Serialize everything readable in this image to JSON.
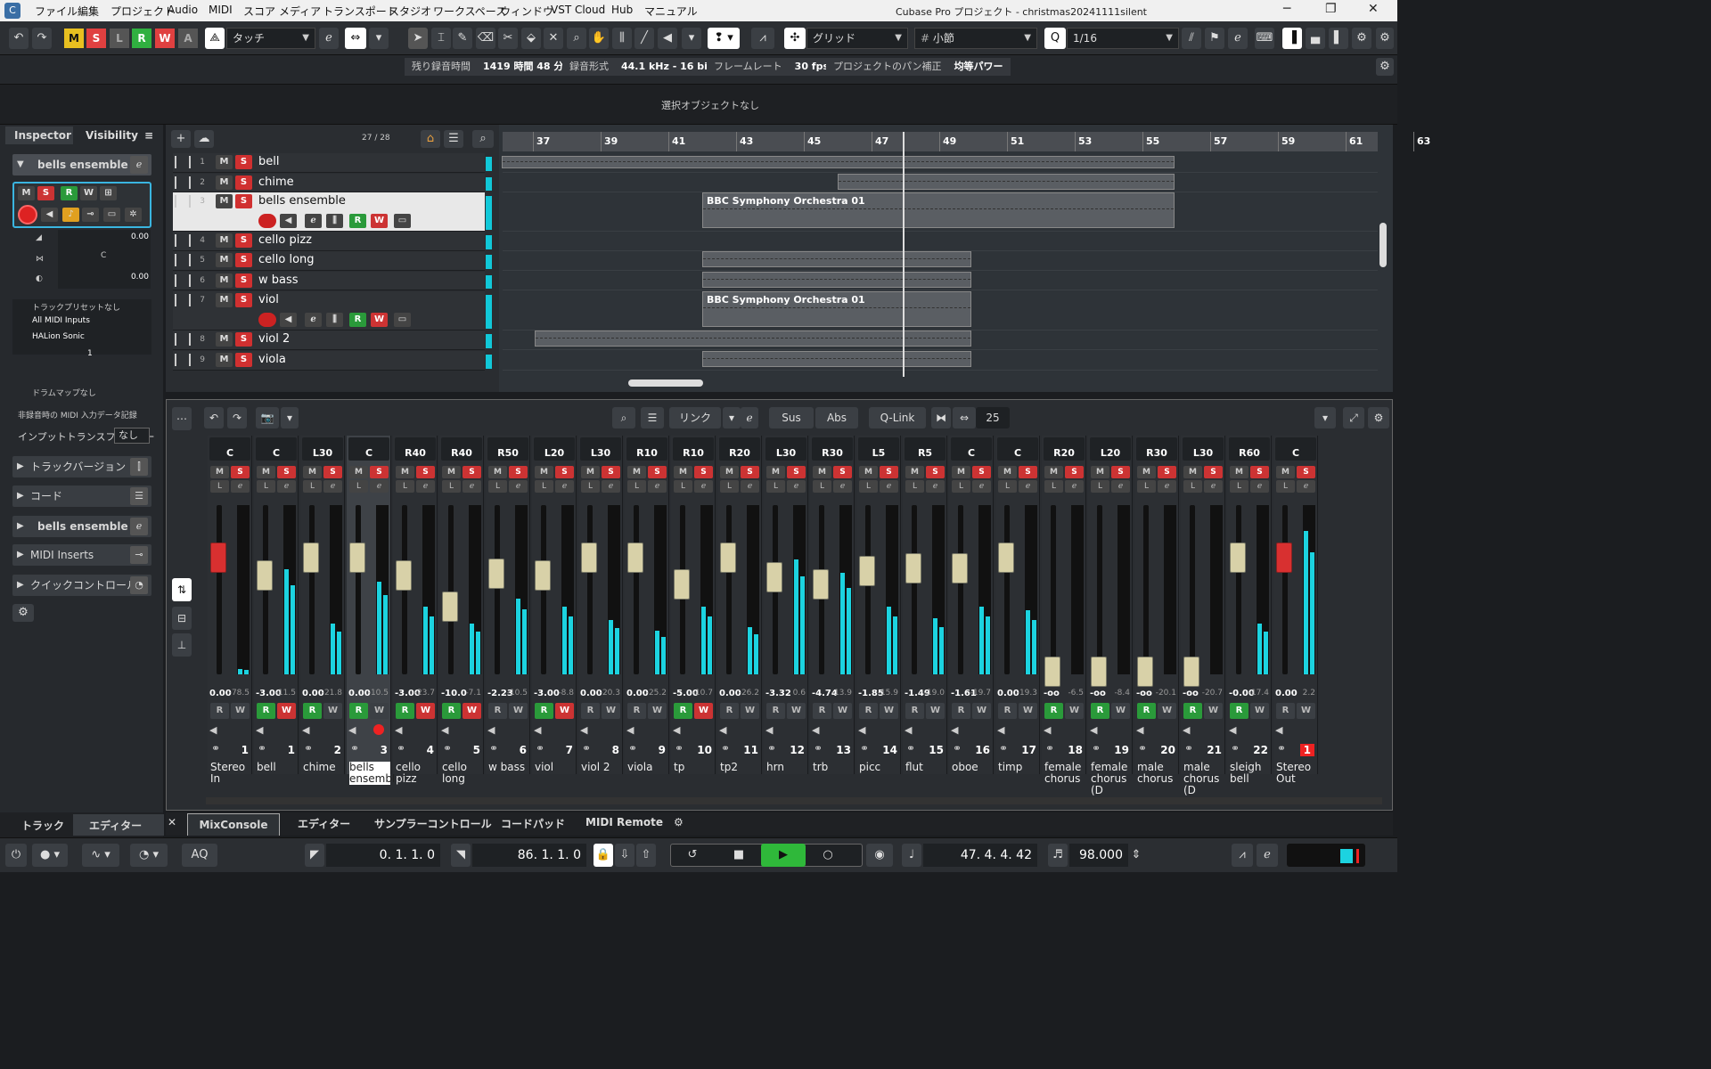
{
  "menu": [
    "ファイル",
    "編集",
    "プロジェクト",
    "Audio",
    "MIDI",
    "スコア",
    "メディア",
    "トランスポート",
    "スタジオ",
    "ワークスペース",
    "ウィンドウ",
    "VST Cloud",
    "Hub",
    "マニュアル"
  ],
  "window_title": "Cubase Pro プロジェクト - christmas20241111silent",
  "toolbar": {
    "modes": [
      "M",
      "S",
      "L",
      "R",
      "W",
      "A"
    ],
    "automation_mode": "タッチ",
    "snap_type": "グリッド",
    "grid_type": "小節",
    "quantize": "1/16"
  },
  "status": {
    "rec_time_label": "残り録音時間",
    "rec_time": "1419 時間 48 分",
    "rec_format_label": "録音形式",
    "rec_format": "44.1 kHz - 16 bit",
    "frame_rate_label": "フレームレート",
    "frame_rate": "30 fps",
    "pan_label": "プロジェクトのパン補正",
    "pan_value": "均等パワー"
  },
  "info_line": "選択オブジェクトなし",
  "inspector": {
    "tab_inspector": "Inspector",
    "tab_visibility": "Visibility",
    "track_name": "bells ensemble",
    "volume": "0.00",
    "pan": "C",
    "delay": "0.00",
    "preset": "トラックプリセットなし",
    "input": "All MIDI Inputs",
    "output": "HALion Sonic",
    "channel": "1",
    "drum_map": "ドラムマップなし",
    "midi_record": "非録音時の MIDI 入力データ記録",
    "input_transformer_label": "インプットトランスフォーマー",
    "input_transformer_value": "なし",
    "sections": [
      "トラックバージョン",
      "コード",
      "bells ensemble",
      "MIDI Inserts",
      "クイックコントロール"
    ]
  },
  "tracklist": {
    "counter": "27 / 28",
    "tracks": [
      {
        "num": "1",
        "name": "bell"
      },
      {
        "num": "2",
        "name": "chime"
      },
      {
        "num": "3",
        "name": "bells ensemble"
      },
      {
        "num": "4",
        "name": "cello pizz"
      },
      {
        "num": "5",
        "name": "cello long"
      },
      {
        "num": "6",
        "name": "w bass"
      },
      {
        "num": "7",
        "name": "viol"
      },
      {
        "num": "8",
        "name": "viol  2"
      },
      {
        "num": "9",
        "name": "viola"
      }
    ]
  },
  "ruler": [
    "37",
    "39",
    "41",
    "43",
    "45",
    "47",
    "49",
    "51",
    "53",
    "55",
    "57",
    "59",
    "61",
    "63"
  ],
  "parts": {
    "bbc": "BBC Symphony Orchestra 01"
  },
  "mixer": {
    "link": "リンク",
    "sus": "Sus",
    "abs": "Abs",
    "qlink": "Q-Link",
    "count": "25",
    "channels": [
      {
        "pan": "C",
        "val": "0.00",
        "pk": "-78.5",
        "num": "1",
        "name": "Stereo In"
      },
      {
        "pan": "C",
        "val": "-3.00",
        "pk": "-11.5",
        "num": "1",
        "name": "bell"
      },
      {
        "pan": "L30",
        "val": "0.00",
        "pk": "-21.8",
        "num": "2",
        "name": "chime"
      },
      {
        "pan": "C",
        "val": "0.00",
        "pk": "-10.5",
        "num": "3",
        "name": "bells ensembl"
      },
      {
        "pan": "R40",
        "val": "-3.00",
        "pk": "-23.7",
        "num": "4",
        "name": "cello pizz"
      },
      {
        "pan": "R40",
        "val": "-10.0",
        "pk": "-7.1",
        "num": "5",
        "name": "cello long"
      },
      {
        "pan": "R50",
        "val": "-2.23",
        "pk": "-10.5",
        "num": "6",
        "name": "w bass"
      },
      {
        "pan": "L20",
        "val": "-3.00",
        "pk": "-8.8",
        "num": "7",
        "name": "viol"
      },
      {
        "pan": "L30",
        "val": "0.00",
        "pk": "-20.3",
        "num": "8",
        "name": "viol  2"
      },
      {
        "pan": "R10",
        "val": "0.00",
        "pk": "-25.2",
        "num": "9",
        "name": "viola"
      },
      {
        "pan": "R10",
        "val": "-5.00",
        "pk": "-10.7",
        "num": "10",
        "name": "tp"
      },
      {
        "pan": "R20",
        "val": "0.00",
        "pk": "-26.2",
        "num": "11",
        "name": "tp2"
      },
      {
        "pan": "L30",
        "val": "-3.32",
        "pk": "0.6",
        "num": "12",
        "name": "hrn"
      },
      {
        "pan": "R30",
        "val": "-4.74",
        "pk": "-13.9",
        "num": "13",
        "name": "trb"
      },
      {
        "pan": "L5",
        "val": "-1.85",
        "pk": "-15.9",
        "num": "14",
        "name": "picc"
      },
      {
        "pan": "R5",
        "val": "-1.49",
        "pk": "-19.0",
        "num": "15",
        "name": "flut"
      },
      {
        "pan": "C",
        "val": "-1.61",
        "pk": "-19.7",
        "num": "16",
        "name": "oboe"
      },
      {
        "pan": "C",
        "val": "0.00",
        "pk": "-19.3",
        "num": "17",
        "name": "timp"
      },
      {
        "pan": "R20",
        "val": "-oo",
        "pk": "-6.5",
        "num": "18",
        "name": "female chorus"
      },
      {
        "pan": "L20",
        "val": "-oo",
        "pk": "-8.4",
        "num": "19",
        "name": "female chorus (D"
      },
      {
        "pan": "R30",
        "val": "-oo",
        "pk": "-20.1",
        "num": "20",
        "name": "male chorus"
      },
      {
        "pan": "L30",
        "val": "-oo",
        "pk": "-20.7",
        "num": "21",
        "name": "male chorus (D"
      },
      {
        "pan": "R60",
        "val": "-0.00",
        "pk": "-17.4",
        "num": "22",
        "name": "sleigh bell"
      },
      {
        "pan": "C",
        "val": "0.00",
        "pk": "2.2",
        "num": "1",
        "name": "Stereo Out"
      }
    ]
  },
  "bottom_tabs": {
    "track": "トラック",
    "editor_left": "エディター",
    "mixconsole": "MixConsole",
    "editor": "エディター",
    "sampler": "サンプラーコントロール",
    "chordpad": "コードパッド",
    "midi_remote": "MIDI Remote"
  },
  "transport": {
    "aq": "AQ",
    "left_locator": "0. 1. 1.   0",
    "right_locator": "86. 1. 1.   0",
    "position": "47. 4. 4. 42",
    "tempo": "98.000"
  }
}
